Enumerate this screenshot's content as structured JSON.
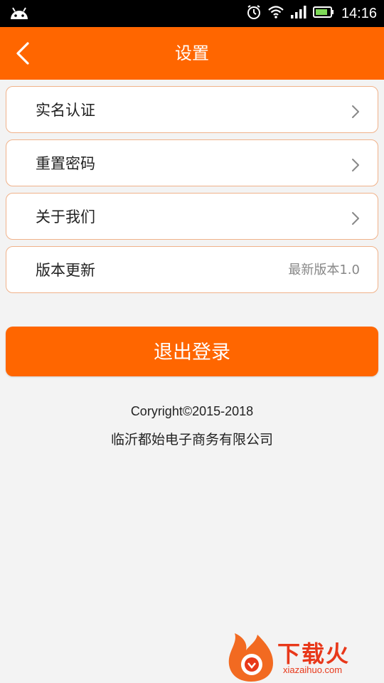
{
  "status_bar": {
    "time": "14:16",
    "icons": [
      "android-icon",
      "alarm-icon",
      "wifi-icon",
      "signal-icon",
      "battery-icon"
    ]
  },
  "app_bar": {
    "title": "设置",
    "back_icon": "chevron-left-icon"
  },
  "menu": {
    "items": [
      {
        "label": "实名认证",
        "value": ""
      },
      {
        "label": "重置密码",
        "value": ""
      },
      {
        "label": "关于我们",
        "value": ""
      },
      {
        "label": "版本更新",
        "value": "最新版本1.0"
      }
    ]
  },
  "logout_label": "退出登录",
  "footer": {
    "copyright": "Coryright©2015-2018",
    "company": "临沂都始电子商务有限公司"
  },
  "watermark": {
    "text": "下载火",
    "sub": "xiazaihuo.com"
  },
  "colors": {
    "accent": "#ff6600",
    "item_border": "#f0b28a",
    "background": "#f3f3f3"
  }
}
